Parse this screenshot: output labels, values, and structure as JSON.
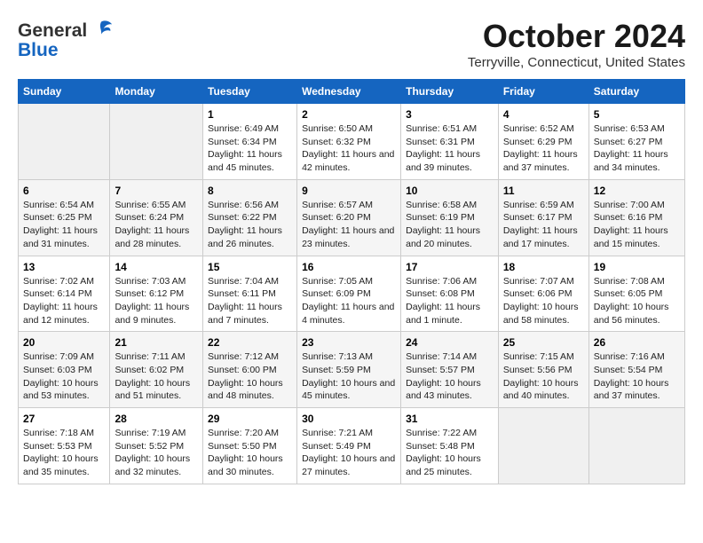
{
  "header": {
    "logo_general": "General",
    "logo_blue": "Blue",
    "month": "October 2024",
    "location": "Terryville, Connecticut, United States"
  },
  "days_of_week": [
    "Sunday",
    "Monday",
    "Tuesday",
    "Wednesday",
    "Thursday",
    "Friday",
    "Saturday"
  ],
  "weeks": [
    [
      {
        "day": "",
        "info": ""
      },
      {
        "day": "",
        "info": ""
      },
      {
        "day": "1",
        "info": "Sunrise: 6:49 AM\nSunset: 6:34 PM\nDaylight: 11 hours and 45 minutes."
      },
      {
        "day": "2",
        "info": "Sunrise: 6:50 AM\nSunset: 6:32 PM\nDaylight: 11 hours and 42 minutes."
      },
      {
        "day": "3",
        "info": "Sunrise: 6:51 AM\nSunset: 6:31 PM\nDaylight: 11 hours and 39 minutes."
      },
      {
        "day": "4",
        "info": "Sunrise: 6:52 AM\nSunset: 6:29 PM\nDaylight: 11 hours and 37 minutes."
      },
      {
        "day": "5",
        "info": "Sunrise: 6:53 AM\nSunset: 6:27 PM\nDaylight: 11 hours and 34 minutes."
      }
    ],
    [
      {
        "day": "6",
        "info": "Sunrise: 6:54 AM\nSunset: 6:25 PM\nDaylight: 11 hours and 31 minutes."
      },
      {
        "day": "7",
        "info": "Sunrise: 6:55 AM\nSunset: 6:24 PM\nDaylight: 11 hours and 28 minutes."
      },
      {
        "day": "8",
        "info": "Sunrise: 6:56 AM\nSunset: 6:22 PM\nDaylight: 11 hours and 26 minutes."
      },
      {
        "day": "9",
        "info": "Sunrise: 6:57 AM\nSunset: 6:20 PM\nDaylight: 11 hours and 23 minutes."
      },
      {
        "day": "10",
        "info": "Sunrise: 6:58 AM\nSunset: 6:19 PM\nDaylight: 11 hours and 20 minutes."
      },
      {
        "day": "11",
        "info": "Sunrise: 6:59 AM\nSunset: 6:17 PM\nDaylight: 11 hours and 17 minutes."
      },
      {
        "day": "12",
        "info": "Sunrise: 7:00 AM\nSunset: 6:16 PM\nDaylight: 11 hours and 15 minutes."
      }
    ],
    [
      {
        "day": "13",
        "info": "Sunrise: 7:02 AM\nSunset: 6:14 PM\nDaylight: 11 hours and 12 minutes."
      },
      {
        "day": "14",
        "info": "Sunrise: 7:03 AM\nSunset: 6:12 PM\nDaylight: 11 hours and 9 minutes."
      },
      {
        "day": "15",
        "info": "Sunrise: 7:04 AM\nSunset: 6:11 PM\nDaylight: 11 hours and 7 minutes."
      },
      {
        "day": "16",
        "info": "Sunrise: 7:05 AM\nSunset: 6:09 PM\nDaylight: 11 hours and 4 minutes."
      },
      {
        "day": "17",
        "info": "Sunrise: 7:06 AM\nSunset: 6:08 PM\nDaylight: 11 hours and 1 minute."
      },
      {
        "day": "18",
        "info": "Sunrise: 7:07 AM\nSunset: 6:06 PM\nDaylight: 10 hours and 58 minutes."
      },
      {
        "day": "19",
        "info": "Sunrise: 7:08 AM\nSunset: 6:05 PM\nDaylight: 10 hours and 56 minutes."
      }
    ],
    [
      {
        "day": "20",
        "info": "Sunrise: 7:09 AM\nSunset: 6:03 PM\nDaylight: 10 hours and 53 minutes."
      },
      {
        "day": "21",
        "info": "Sunrise: 7:11 AM\nSunset: 6:02 PM\nDaylight: 10 hours and 51 minutes."
      },
      {
        "day": "22",
        "info": "Sunrise: 7:12 AM\nSunset: 6:00 PM\nDaylight: 10 hours and 48 minutes."
      },
      {
        "day": "23",
        "info": "Sunrise: 7:13 AM\nSunset: 5:59 PM\nDaylight: 10 hours and 45 minutes."
      },
      {
        "day": "24",
        "info": "Sunrise: 7:14 AM\nSunset: 5:57 PM\nDaylight: 10 hours and 43 minutes."
      },
      {
        "day": "25",
        "info": "Sunrise: 7:15 AM\nSunset: 5:56 PM\nDaylight: 10 hours and 40 minutes."
      },
      {
        "day": "26",
        "info": "Sunrise: 7:16 AM\nSunset: 5:54 PM\nDaylight: 10 hours and 37 minutes."
      }
    ],
    [
      {
        "day": "27",
        "info": "Sunrise: 7:18 AM\nSunset: 5:53 PM\nDaylight: 10 hours and 35 minutes."
      },
      {
        "day": "28",
        "info": "Sunrise: 7:19 AM\nSunset: 5:52 PM\nDaylight: 10 hours and 32 minutes."
      },
      {
        "day": "29",
        "info": "Sunrise: 7:20 AM\nSunset: 5:50 PM\nDaylight: 10 hours and 30 minutes."
      },
      {
        "day": "30",
        "info": "Sunrise: 7:21 AM\nSunset: 5:49 PM\nDaylight: 10 hours and 27 minutes."
      },
      {
        "day": "31",
        "info": "Sunrise: 7:22 AM\nSunset: 5:48 PM\nDaylight: 10 hours and 25 minutes."
      },
      {
        "day": "",
        "info": ""
      },
      {
        "day": "",
        "info": ""
      }
    ]
  ]
}
